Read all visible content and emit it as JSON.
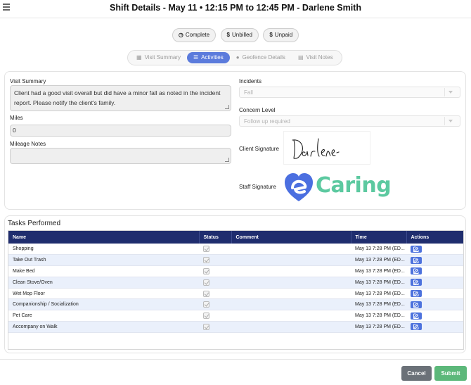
{
  "header": {
    "title": "Shift Details - May 11 • 12:15 PM to 12:45 PM - Darlene Smith"
  },
  "status_pills": [
    {
      "icon": "clock-icon",
      "label": "Complete"
    },
    {
      "icon": "dollar-icon",
      "label": "Unbilled"
    },
    {
      "icon": "dollar-icon",
      "label": "Unpaid"
    }
  ],
  "tabs": [
    {
      "label": "Visit Summary",
      "icon": "document-icon",
      "active": false
    },
    {
      "label": "Activities",
      "icon": "list-icon",
      "active": true
    },
    {
      "label": "Geofence Details",
      "icon": "map-pin-icon",
      "active": false
    },
    {
      "label": "Visit Notes",
      "icon": "notes-icon",
      "active": false
    }
  ],
  "visit_summary": {
    "label": "Visit Summary",
    "value": "Client had a good visit overall but did have a minor fall as noted in the incident report. Please notify the client's family."
  },
  "miles": {
    "label": "Miles",
    "value": "0"
  },
  "mileage_notes": {
    "label": "Mileage Notes",
    "value": ""
  },
  "incidents": {
    "label": "Incidents",
    "value": "Fall"
  },
  "concern_level": {
    "label": "Concern Level",
    "value": "Follow up required"
  },
  "client_signature": {
    "label": "Client Signature",
    "signature_text": "Darlene"
  },
  "staff_signature": {
    "label": "Staff Signature",
    "logo_text": "eCaring",
    "logo_word": "Caring"
  },
  "tasks": {
    "title": "Tasks Performed",
    "columns": [
      "Name",
      "Status",
      "Comment",
      "Time",
      "Actions"
    ],
    "rows": [
      {
        "name": "Shopping",
        "status": true,
        "comment": "",
        "time": "May 13 7:28 PM (ED..."
      },
      {
        "name": "Take Out Trash",
        "status": true,
        "comment": "",
        "time": "May 13 7:28 PM (ED..."
      },
      {
        "name": "Make Bed",
        "status": true,
        "comment": "",
        "time": "May 13 7:28 PM (ED..."
      },
      {
        "name": "Clean Stove/Oven",
        "status": true,
        "comment": "",
        "time": "May 13 7:28 PM (ED..."
      },
      {
        "name": "Wet Mop Floor",
        "status": true,
        "comment": "",
        "time": "May 13 7:28 PM (ED..."
      },
      {
        "name": "Companionship / Socialization",
        "status": true,
        "comment": "",
        "time": "May 13 7:28 PM (ED..."
      },
      {
        "name": "Pet Care",
        "status": true,
        "comment": "",
        "time": "May 13 7:28 PM (ED..."
      },
      {
        "name": "Accompany on Walk",
        "status": true,
        "comment": "",
        "time": "May 13 7:28 PM (ED..."
      }
    ]
  },
  "footer": {
    "cancel_label": "Cancel",
    "submit_label": "Submit"
  },
  "colors": {
    "accent": "#5b7bdc",
    "table_header": "#1f2d6e",
    "submit": "#5cb87a",
    "cancel": "#6b7178",
    "logo_blue": "#4b6fe0",
    "logo_green": "#5cc9a0"
  }
}
